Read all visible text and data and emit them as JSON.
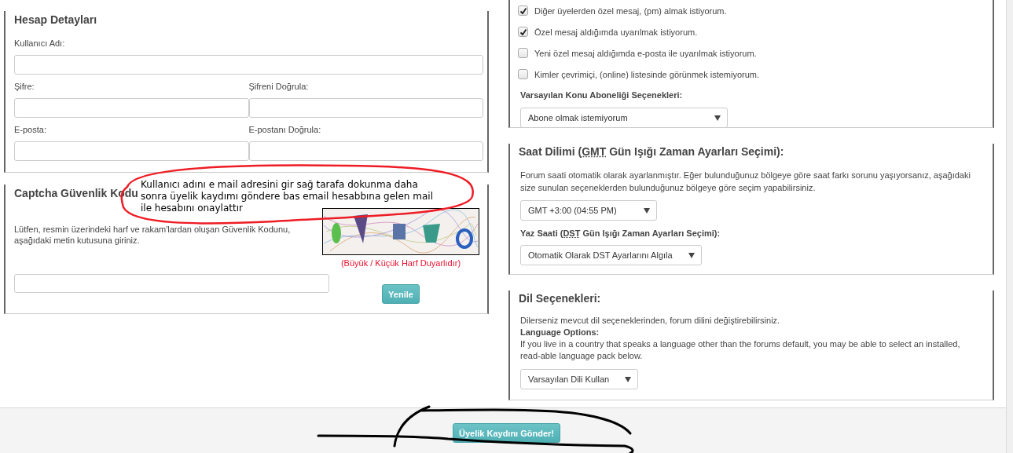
{
  "account": {
    "title": "Hesap Detayları",
    "fields": [
      {
        "label": "Kullanıcı Adı:",
        "wide": true
      },
      {
        "label": "Şifre:",
        "wide": false
      },
      {
        "label": "Şifreni Doğrula:",
        "wide": false
      },
      {
        "label": "E-posta:",
        "wide": false
      },
      {
        "label": "E-postanı Doğrula:",
        "wide": false
      }
    ]
  },
  "captcha": {
    "title": "Captcha Güvenlik Kodu",
    "instructions": "Lütfen, resmin üzerindeki harf ve rakam'lardan oluşan Güvenlik Kodunu, aşağıdaki metin kutusuna giriniz.",
    "case_note": "(Büyük / Küçük Harf Duyarlıdır)",
    "refresh_button": "Yenile"
  },
  "preferences": {
    "options": [
      {
        "label": "Diğer üyelerden özel mesaj, (pm) almak istiyorum.",
        "checked": true
      },
      {
        "label": "Özel mesaj aldığımda uyarılmak istiyorum.",
        "checked": true
      },
      {
        "label": "Yeni özel mesaj aldığımda e-posta ile uyarılmak istiyorum.",
        "checked": false
      },
      {
        "label": "Kimler çevrimiçi, (online) listesinde görünmek istemiyorum.",
        "checked": false
      }
    ],
    "subscription": {
      "label": "Varsayılan Konu Aboneliği Seçenekleri:",
      "value": "Abone olmak istemiyorum"
    }
  },
  "timezone": {
    "title": {
      "before": "Saat Dilimi (",
      "abbr": "GMT",
      "after": " Gün Işığı Zaman Ayarları Seçimi):"
    },
    "description": "Forum saati otomatik olarak ayarlanmıştır. Eğer bulunduğunuz bölgeye göre saat farkı sorunu yaşıyorsanız, aşağıdaki size sunulan seçeneklerden bulunduğunuz bölgeye göre seçim yapabilirsiniz.",
    "zone_value": "GMT +3:00 (04:55 PM)",
    "dst_label": {
      "before": "Yaz Saati (",
      "abbr": "DST",
      "after": " Gün Işığı Zaman Ayarları Seçimi):"
    },
    "dst_value": "Otomatik Olarak DST Ayarlarını Algıla"
  },
  "language": {
    "title": "Dil Seçenekleri:",
    "description": "Dilerseniz mevcut dil seçeneklerinden, forum dilini değiştirebilirsiniz.",
    "subheading": "Language Options:",
    "help": "If you live in a country that speaks a language other than the forums default, you may be able to select an installed, read-able language pack below.",
    "value": "Varsayılan Dili Kullan"
  },
  "submit_button": "Üyelik Kaydını Gönder!",
  "annotation": {
    "note": "Kullanıcı adını e mail adresini gir sağ tarafa dokunma daha sonra üyelik kaydımı göndere bas email hesabbına gelen mail ile hesabını onaylattır"
  }
}
